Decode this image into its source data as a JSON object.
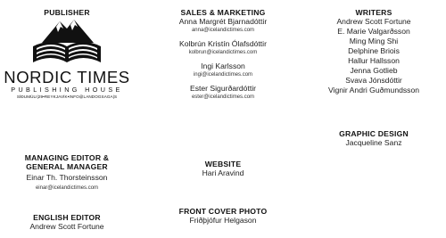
{
  "publisher": {
    "heading": "PUBLISHER",
    "logo_title": "NORDIC TIMES",
    "logo_subtitle": "PUBLISHING HOUSE",
    "logo_address": "SÍÐUMÚLI|29•REYKJAVÍK•INFO@LANDOGSAGA|S"
  },
  "managing_editor": {
    "heading": "MANAGING EDITOR &",
    "heading2": "GENERAL MANAGER",
    "name": "Einar Th. Thorsteinsson",
    "email": "einar@icelandictimes.com"
  },
  "english_editor": {
    "heading": "ENGLISH EDITOR",
    "name": "Andrew Scott Fortune"
  },
  "sales": {
    "heading": "SALES & MARKETING",
    "people": [
      {
        "name": "Anna Margrét Bjarnadóttir",
        "email": "anna@icelandictimes.com"
      },
      {
        "name": "Kolbrún Kristín Ólafsdóttir",
        "email": "kolbrun@icelandictimes.com"
      },
      {
        "name": "Ingi Karlsson",
        "email": "ingi@icelandictimes.com"
      },
      {
        "name": "Ester Sigurðardóttir",
        "email": "ester@icelandictimes.com"
      }
    ]
  },
  "website": {
    "heading": "WEBSITE",
    "name": "Hari Aravind"
  },
  "front_cover": {
    "heading": "FRONT COVER PHOTO",
    "name": "Friðþjófur Helgason"
  },
  "writers": {
    "heading": "WRITERS",
    "names": [
      "Andrew Scott Fortune",
      "E. Marie Valgarðsson",
      "Ming Ming Shi",
      "Delphine Briois",
      "Hallur Hallsson",
      "Jenna Gotlieb",
      "Svava Jónsdóttir",
      "Vignir Andri Guðmundsson"
    ]
  },
  "graphic_design": {
    "heading": "GRAPHIC DESIGN",
    "name": "Jacqueline Sanz"
  }
}
